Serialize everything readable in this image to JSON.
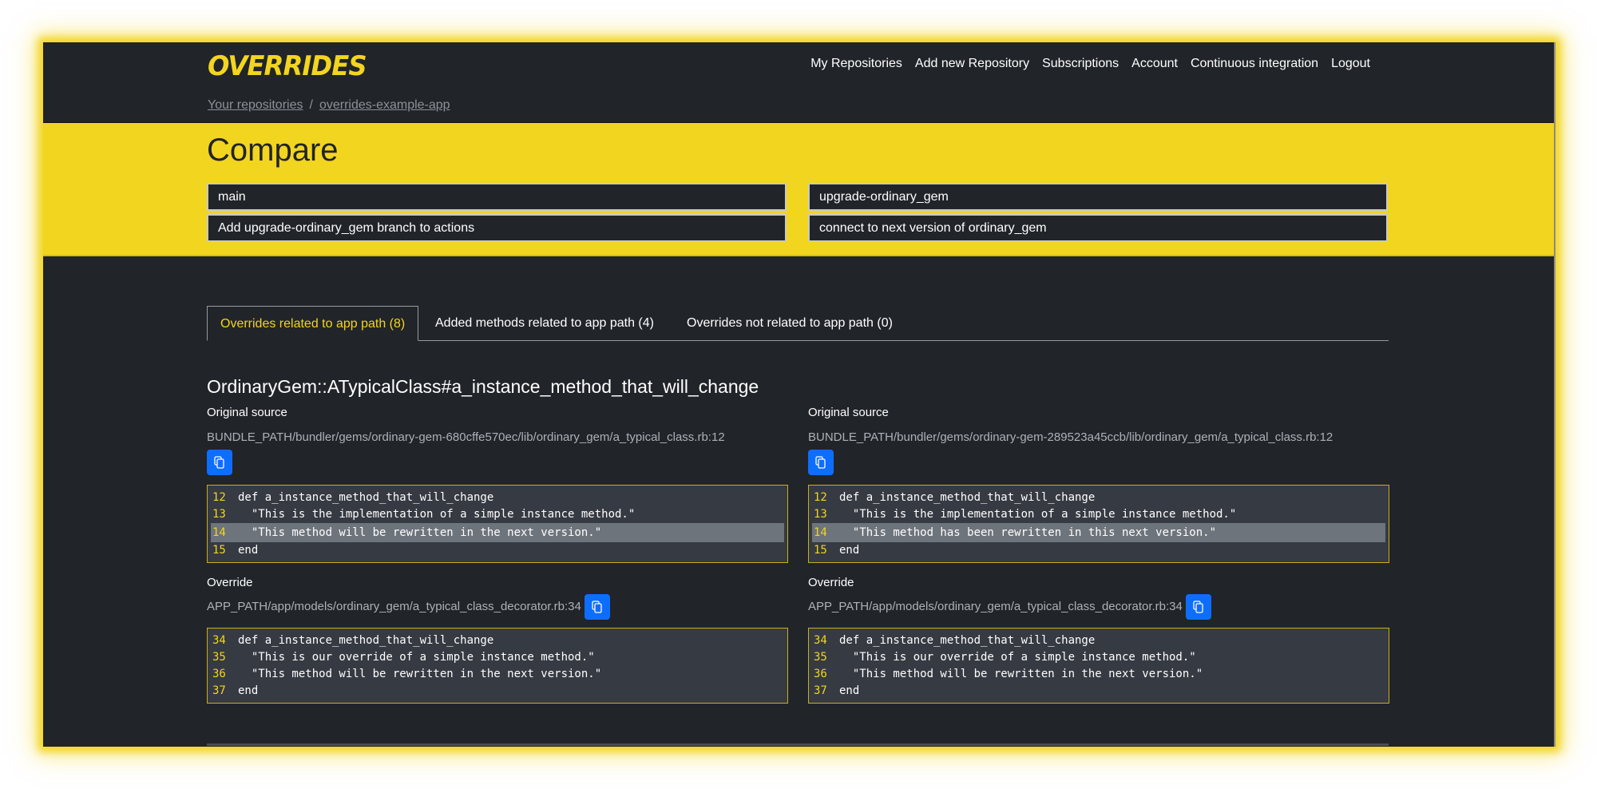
{
  "app": {
    "logo": "OVERRIDES",
    "accent_color": "#f2d51f",
    "primary_button_color": "#0d6efd"
  },
  "nav": {
    "items": [
      {
        "label": "My Repositories"
      },
      {
        "label": "Add new Repository"
      },
      {
        "label": "Subscriptions"
      },
      {
        "label": "Account"
      },
      {
        "label": "Continuous integration"
      },
      {
        "label": "Logout"
      }
    ]
  },
  "breadcrumb": {
    "items": [
      {
        "label": "Your repositories"
      },
      {
        "label": "overrides-example-app"
      }
    ],
    "separator": "/"
  },
  "compare": {
    "title": "Compare",
    "left": {
      "branch": "main",
      "commit": "Add upgrade-ordinary_gem branch to actions"
    },
    "right": {
      "branch": "upgrade-ordinary_gem",
      "commit": "connect to next version of ordinary_gem"
    }
  },
  "tabs": [
    {
      "label": "Overrides related to app path (8)",
      "active": true
    },
    {
      "label": "Added methods related to app path (4)",
      "active": false
    },
    {
      "label": "Overrides not related to app path (0)",
      "active": false
    }
  ],
  "method": {
    "title": "OrdinaryGem::ATypicalClass#a_instance_method_that_will_change",
    "columns": [
      {
        "original_label": "Original source",
        "original_path": "BUNDLE_PATH/bundler/gems/ordinary-gem-680cffe570ec/lib/ordinary_gem/a_typical_class.rb:12",
        "original_code": [
          {
            "n": "12",
            "text": "def a_instance_method_that_will_change"
          },
          {
            "n": "13",
            "text": "  \"This is the implementation of a simple instance method.\""
          },
          {
            "n": "14",
            "text": "  \"This method will be rewritten in the next version.\"",
            "highlight": true
          },
          {
            "n": "15",
            "text": "end"
          }
        ],
        "override_label": "Override",
        "override_path": "APP_PATH/app/models/ordinary_gem/a_typical_class_decorator.rb:34",
        "override_code": [
          {
            "n": "34",
            "text": "def a_instance_method_that_will_change"
          },
          {
            "n": "35",
            "text": "  \"This is our override of a simple instance method.\""
          },
          {
            "n": "36",
            "text": "  \"This method will be rewritten in the next version.\""
          },
          {
            "n": "37",
            "text": "end"
          }
        ]
      },
      {
        "original_label": "Original source",
        "original_path": "BUNDLE_PATH/bundler/gems/ordinary-gem-289523a45ccb/lib/ordinary_gem/a_typical_class.rb:12",
        "original_code": [
          {
            "n": "12",
            "text": "def a_instance_method_that_will_change"
          },
          {
            "n": "13",
            "text": "  \"This is the implementation of a simple instance method.\""
          },
          {
            "n": "14",
            "text": "  \"This method has been rewritten in this next version.\"",
            "highlight": true
          },
          {
            "n": "15",
            "text": "end"
          }
        ],
        "override_label": "Override",
        "override_path": "APP_PATH/app/models/ordinary_gem/a_typical_class_decorator.rb:34",
        "override_code": [
          {
            "n": "34",
            "text": "def a_instance_method_that_will_change"
          },
          {
            "n": "35",
            "text": "  \"This is our override of a simple instance method.\""
          },
          {
            "n": "36",
            "text": "  \"This method will be rewritten in the next version.\""
          },
          {
            "n": "37",
            "text": "end"
          }
        ]
      }
    ]
  },
  "icons": {
    "copy": "copy-icon"
  }
}
